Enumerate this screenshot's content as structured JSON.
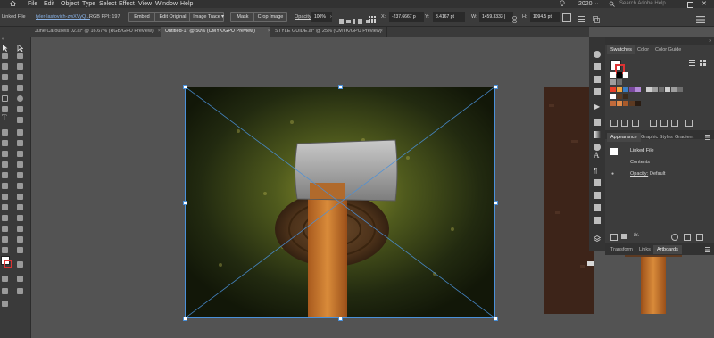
{
  "menubar": {
    "items": [
      "File",
      "Edit",
      "Object",
      "Type",
      "Select",
      "Effect",
      "View",
      "Window",
      "Help"
    ],
    "year": "2020",
    "search_placeholder": "Search Adobe Help"
  },
  "controlbar": {
    "selection_label": "Linked File",
    "file_name": "tyler-lastovich-zwXVyQ...",
    "color_info": "RGB  PPI: 197",
    "embed": "Embed",
    "edit_original": "Edit Original",
    "image_trace": "Image Trace",
    "mask": "Mask",
    "crop_image": "Crop Image",
    "opacity_label": "Opacity:",
    "opacity_value": "100%",
    "x_label": "X:",
    "x_value": "-237.6667 p",
    "y_label": "Y:",
    "y_value": "3.4167 pt",
    "w_label": "W:",
    "w_value": "1459.3333 |",
    "h_label": "H:",
    "h_value": "1094.5 pt"
  },
  "tabs": [
    {
      "label": "June Carousels 02.ai* @ 16.67% (RGB/GPU Preview)",
      "active": false
    },
    {
      "label": "Untitled-1* @ 50% (CMYK/GPU Preview)",
      "active": true
    },
    {
      "label": "STYLE GUIDE.ai* @ 25% (CMYK/GPU Preview)",
      "active": false
    }
  ],
  "swatches_panel": {
    "tabs": [
      "Swatches",
      "Color",
      "Color Guide"
    ],
    "colors": [
      "#ffffff",
      "#000000",
      "#e8402a",
      "#f0a33c",
      "#f6d64a",
      "#5aa453",
      "#3c7fc3",
      "#7b4aa0",
      "#b38ad8",
      "#ffffff",
      "#cfcfcf",
      "#9e9e9e",
      "#6e6e6e",
      "#c06a3b",
      "#e08a4a",
      "#a85a2a",
      "#5c3a22",
      "#3a2a1c",
      "#2a1c12"
    ]
  },
  "appearance_panel": {
    "tabs": [
      "Appearance",
      "Graphic Styles",
      "Gradient"
    ],
    "object_label": "Linked File",
    "contents_label": "Contents",
    "opacity_label": "Opacity:",
    "opacity_value": "Default",
    "fx_label": "fx."
  },
  "bottom_panel": {
    "tabs": [
      "Transform",
      "Links",
      "Artboards"
    ]
  },
  "colors": {
    "accent": "#4a90d9",
    "app_bg": "#535353",
    "panel_bg": "#3c3c3c"
  }
}
